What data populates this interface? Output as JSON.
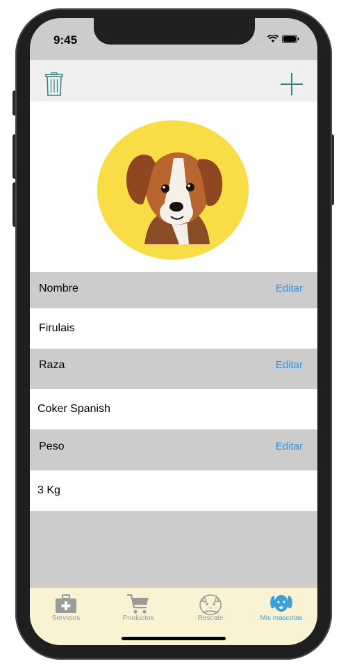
{
  "status": {
    "time": "9:45"
  },
  "toolbar": {
    "delete_icon": "trash-icon",
    "add_icon": "plus-icon",
    "accent": "#2f7f7f"
  },
  "pet": {
    "photo_icon": "dog-photo",
    "circle_color": "#f8dd47"
  },
  "fields": [
    {
      "label": "Nombre",
      "edit": "Editar",
      "value": "Firulais"
    },
    {
      "label": "Raza",
      "edit": "Editar",
      "value": "Coker Spanish"
    },
    {
      "label": "Peso",
      "edit": "Editar",
      "value": "3 Kg"
    }
  ],
  "tabs": [
    {
      "label": "Servicios",
      "icon": "medical-kit-icon",
      "active": false
    },
    {
      "label": "Productos",
      "icon": "cart-icon",
      "active": false
    },
    {
      "label": "Rescate",
      "icon": "pets-rescue-icon",
      "active": false
    },
    {
      "label": "Mis mascotas",
      "icon": "dog-head-icon",
      "active": true
    }
  ],
  "colors": {
    "edit_link": "#2f8fe0",
    "tab_active": "#3aa0d6",
    "tab_bar": "#f9f2d3",
    "section_header": "#cccccc"
  }
}
